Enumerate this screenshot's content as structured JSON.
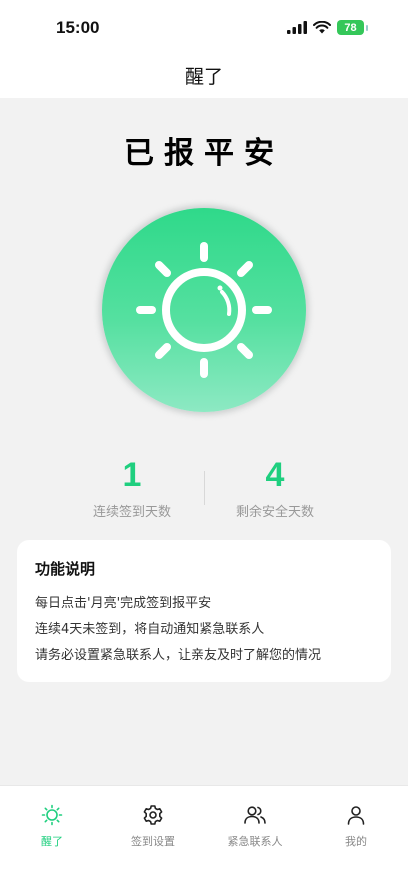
{
  "status_bar": {
    "time": "15:00",
    "battery": "78"
  },
  "nav": {
    "title": "醒了"
  },
  "main": {
    "title": "已报平安",
    "sun_icon": "sun-icon"
  },
  "stats": [
    {
      "value": "1",
      "label": "连续签到天数"
    },
    {
      "value": "4",
      "label": "剩余安全天数"
    }
  ],
  "card": {
    "title": "功能说明",
    "lines": [
      "每日点击'月亮'完成签到报平安",
      "连续4天未签到，将自动通知紧急联系人",
      "请务必设置紧急联系人，让亲友及时了解您的情况"
    ]
  },
  "tabs": [
    {
      "label": "醒了",
      "icon": "sun-icon",
      "active": true
    },
    {
      "label": "签到设置",
      "icon": "gear-icon",
      "active": false
    },
    {
      "label": "紧急联系人",
      "icon": "contacts-icon",
      "active": false
    },
    {
      "label": "我的",
      "icon": "person-icon",
      "active": false
    }
  ],
  "colors": {
    "accent": "#1fcf7f",
    "sun_top": "#2fd98a",
    "sun_bottom": "#8de9c3"
  }
}
